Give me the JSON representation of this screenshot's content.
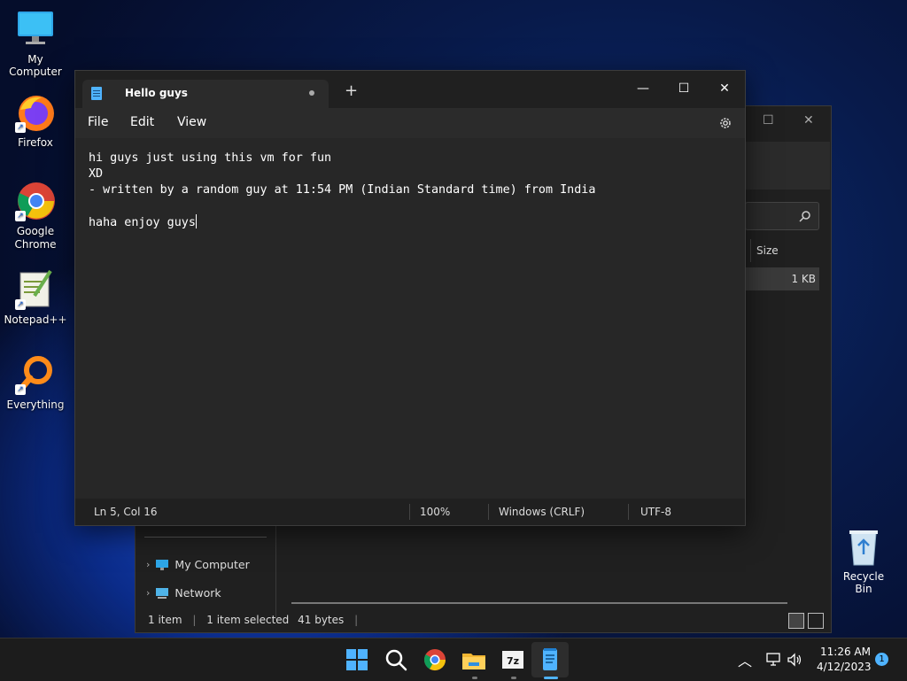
{
  "desktop": {
    "icons": [
      {
        "label": "My Computer",
        "icon": "monitor-icon"
      },
      {
        "label": "Firefox",
        "icon": "firefox-icon"
      },
      {
        "label": "Google Chrome",
        "icon": "chrome-icon"
      },
      {
        "label": "Notepad++",
        "icon": "notepadpp-icon"
      },
      {
        "label": "Everything",
        "icon": "search-magnifier-icon"
      }
    ],
    "recycle_bin": "Recycle Bin"
  },
  "explorer": {
    "column_size": "Size",
    "file_size": "1 KB",
    "nav": [
      "My Computer",
      "Network"
    ],
    "status": {
      "items": "1 item",
      "selected": "1 item selected",
      "bytes": "41 bytes"
    },
    "controls": {
      "maximize": "☐",
      "close": "✕"
    }
  },
  "notepad": {
    "tab_title": "Hello guys",
    "add_tab": "+",
    "controls": {
      "minimize": "—",
      "maximize": "☐",
      "close": "✕"
    },
    "menu": [
      "File",
      "Edit",
      "View"
    ],
    "content": {
      "line1": "hi guys just using this vm for fun",
      "line2": "XD",
      "line3": "- written by a random guy at 11:54 PM (Indian Standard time) from India",
      "line4": "",
      "line5": "haha enjoy guys"
    },
    "status": {
      "position": "Ln 5, Col 16",
      "zoom": "100%",
      "line_ending": "Windows (CRLF)",
      "encoding": "UTF-8"
    }
  },
  "taskbar": {
    "time": "11:26 AM",
    "date": "4/12/2023",
    "notification_count": "1",
    "apps": [
      "start-icon",
      "search-icon",
      "chrome-icon",
      "file-explorer-icon",
      "7zip-icon",
      "notepad-icon"
    ]
  },
  "colors": {
    "accent": "#4fb3ff",
    "notepad_bg": "#272727",
    "taskbar_bg": "#1c1c1c"
  }
}
